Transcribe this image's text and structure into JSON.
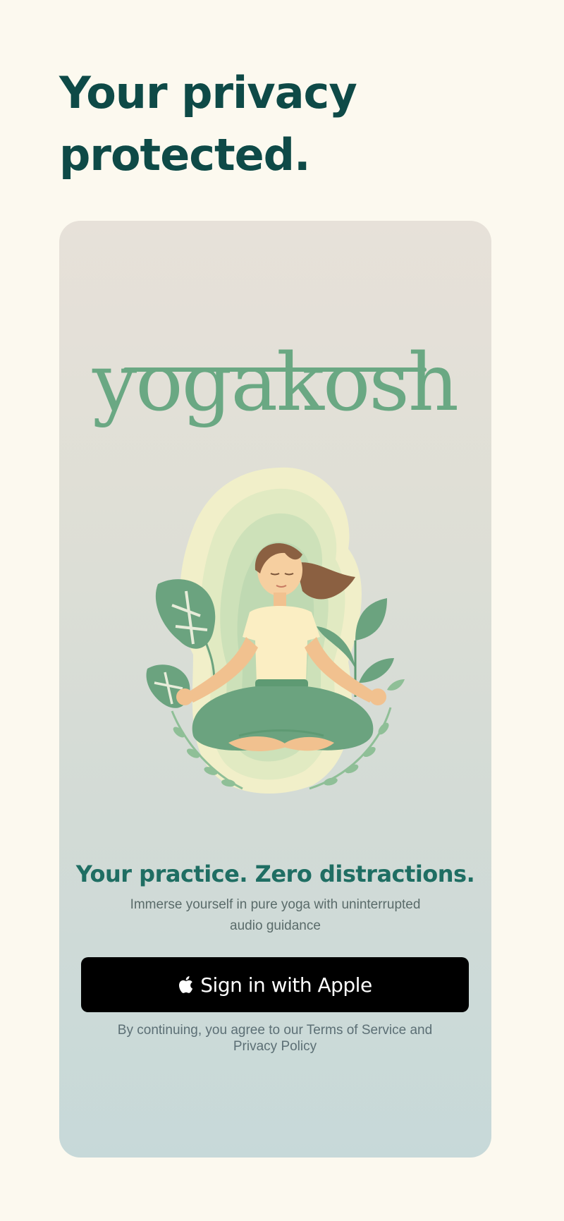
{
  "headline": "Your privacy protected.",
  "brand": {
    "logo_text": "yogakosh",
    "logo_color": "#6aa883"
  },
  "illustration": {
    "name": "meditating-woman-illustration"
  },
  "tagline": "Your practice. Zero distractions.",
  "subtitle": "Immerse yourself in pure yoga with uninterrupted audio guidance",
  "apple_button": {
    "icon": "apple-icon",
    "label": "Sign in with Apple"
  },
  "legal": "By continuing, you agree to our Terms of Service and Privacy Policy",
  "colors": {
    "background": "#fcf9ef",
    "headline": "#0e4a47",
    "tagline": "#1f6e63",
    "button": "#000000"
  }
}
